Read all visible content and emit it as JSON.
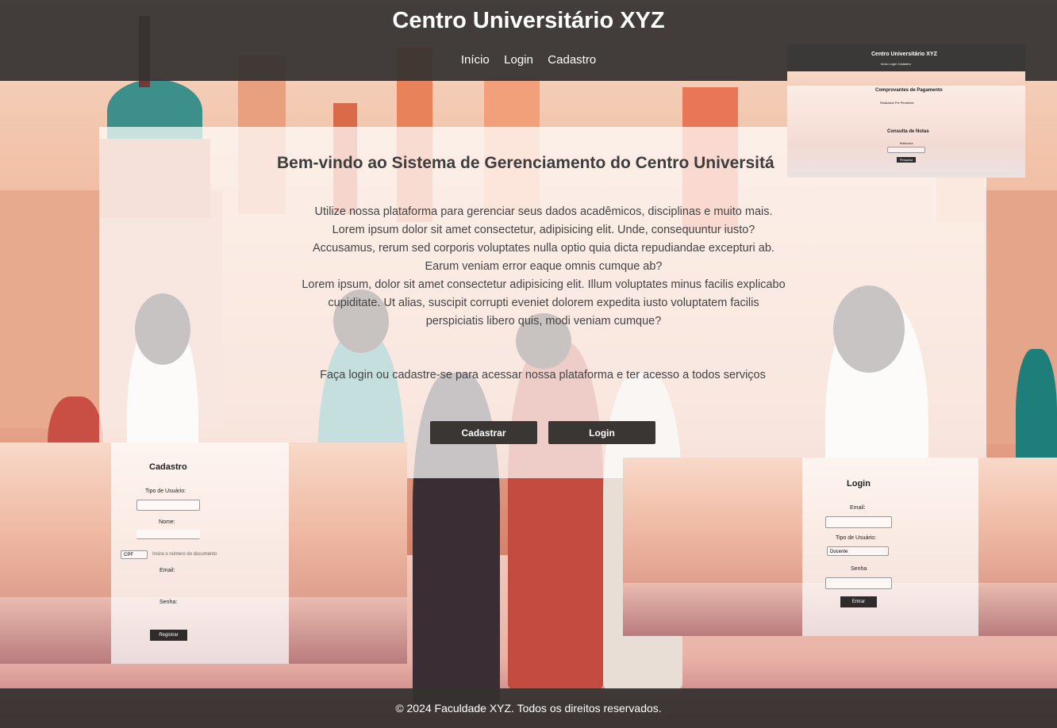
{
  "header": {
    "title": "Centro Universitário XYZ",
    "nav": [
      "Início",
      "Login",
      "Cadastro"
    ]
  },
  "welcome": {
    "heading": "Bem-vindo ao Sistema de Gerenciamento do Centro Universitá",
    "intro": [
      "Utilize nossa plataforma para gerenciar seus dados acadêmicos, disciplinas e muito mais.",
      "Lorem ipsum dolor sit amet consectetur, adipisicing elit. Unde, consequuntur iusto? Accusamus, rerum sed corporis voluptates nulla optio quia dicta repudiandae excepturi ab. Earum veniam error eaque omnis cumque ab?",
      "Lorem ipsum, dolor sit amet consectetur adipisicing elit. Illum voluptates minus facilis explicabo cupiditate. Ut alias, suscipit corrupti eveniet dolorem expedita iusto voluptatem facilis perspiciatis libero quis, modi veniam cumque?"
    ],
    "cta": "Faça login ou cadastre-se para acessar nossa plataforma e ter acesso a todos serviços",
    "btn_cadastrar": "Cadastrar",
    "btn_login": "Login"
  },
  "cadastro_preview": {
    "title": "Cadastro",
    "tipo_label": "Tipo de Usuário:",
    "nome_label": "Nome:",
    "doc_select": "CPF",
    "doc_placeholder": "Insira o número do documento",
    "email_label": "Email:",
    "senha_label": "Senha:",
    "submit": "Registrar"
  },
  "login_preview": {
    "title": "Login",
    "email_label": "Email:",
    "tipo_label": "Tipo de Usuário:",
    "tipo_value": "Docente",
    "senha_label": "Senha",
    "submit": "Entrar"
  },
  "pagamento_preview": {
    "site_title": "Centro Universitário XYZ",
    "nav": "Início  Login  Cadastro",
    "section1": "Comprovantes de Pagamento",
    "section1_row": "Realizado      Pix      Pendente",
    "section2": "Consulta de Notas",
    "section2_field": "Matrícula",
    "section2_button": "Pesquisa"
  },
  "footer": {
    "text": "© 2024 Faculdade XYZ. Todos os direitos reservados."
  },
  "colors": {
    "header_bg": "#343230",
    "button_bg": "#3a3634",
    "text": "#444444"
  }
}
